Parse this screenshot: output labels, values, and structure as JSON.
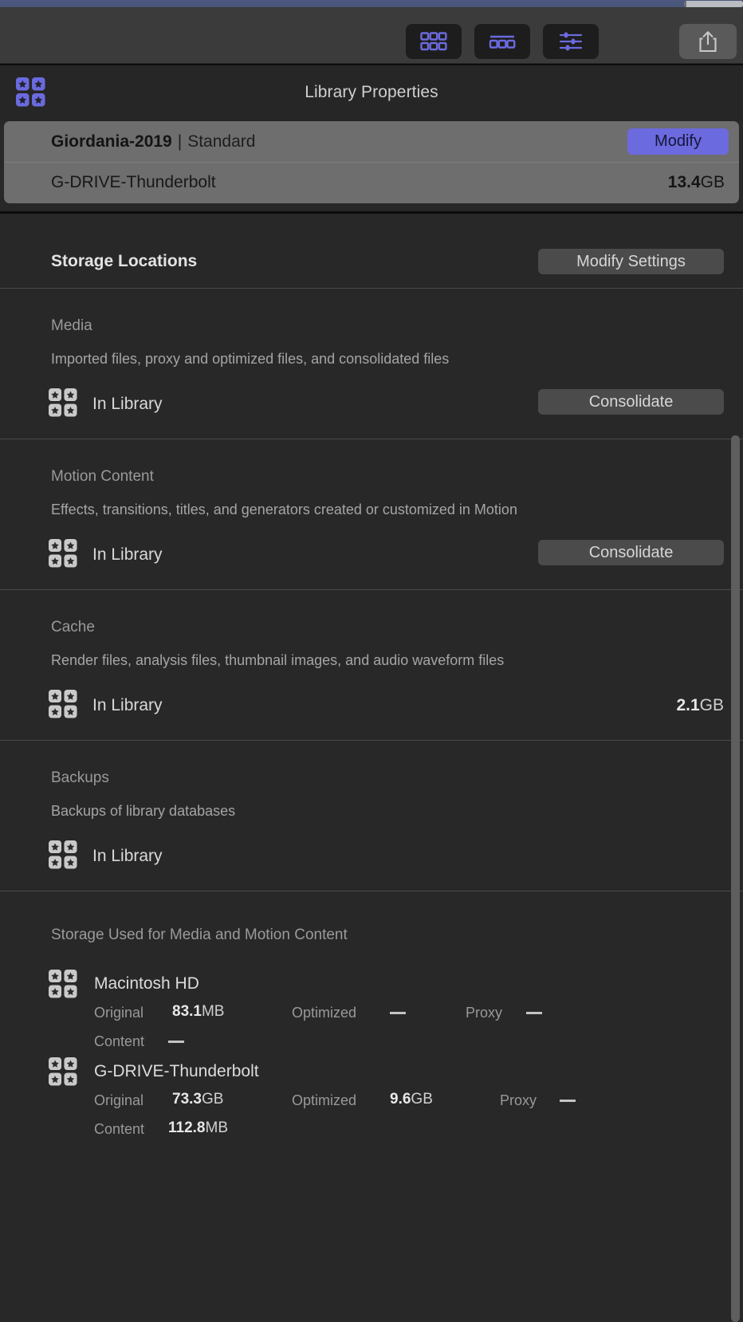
{
  "toolbar": {
    "buttons": [
      {
        "name": "browser-view-button",
        "icon": "grid-six-icon"
      },
      {
        "name": "filmstrip-view-button",
        "icon": "filmstrip-icon"
      },
      {
        "name": "inspector-settings-button",
        "icon": "sliders-icon"
      }
    ],
    "share": {
      "label": "Share",
      "icon": "share-icon"
    },
    "accent_color": "#6b6ade"
  },
  "inspector": {
    "title": "Library Properties",
    "library_icon": "library-stars-icon"
  },
  "library_summary": {
    "name": "Giordania-2019",
    "separator": "|",
    "kind": "Standard",
    "modify_label": "Modify",
    "volume": "G-DRIVE-Thunderbolt",
    "size_value": "13.4",
    "size_unit": "GB"
  },
  "storage_locations": {
    "title": "Storage Locations",
    "modify_settings_label": "Modify Settings",
    "sections": [
      {
        "label": "Media",
        "description": "Imported files, proxy and optimized files, and consolidated files",
        "location": "In Library",
        "action_label": "Consolidate",
        "size_value": "",
        "size_unit": ""
      },
      {
        "label": "Motion Content",
        "description": "Effects, transitions, titles, and generators created or customized in Motion",
        "location": "In Library",
        "action_label": "Consolidate",
        "size_value": "",
        "size_unit": ""
      },
      {
        "label": "Cache",
        "description": "Render files, analysis files, thumbnail images, and audio waveform files",
        "location": "In Library",
        "action_label": "",
        "size_value": "2.1",
        "size_unit": "GB"
      },
      {
        "label": "Backups",
        "description": "Backups of library databases",
        "location": "In Library",
        "action_label": "",
        "size_value": "",
        "size_unit": ""
      }
    ]
  },
  "storage_used": {
    "title": "Storage Used for Media and Motion Content",
    "volumes": [
      {
        "name": "Macintosh HD",
        "original_label": "Original",
        "original_value": "83.1",
        "original_unit": "MB",
        "optimized_label": "Optimized",
        "optimized_value": "—",
        "optimized_unit": "",
        "proxy_label": "Proxy",
        "proxy_value": "—",
        "proxy_unit": "",
        "content_label": "Content",
        "content_value": "—",
        "content_unit": ""
      },
      {
        "name": "G-DRIVE-Thunderbolt",
        "original_label": "Original",
        "original_value": "73.3",
        "original_unit": "GB",
        "optimized_label": "Optimized",
        "optimized_value": "9.6",
        "optimized_unit": "GB",
        "proxy_label": "Proxy",
        "proxy_value": "—",
        "proxy_unit": "",
        "content_label": "Content",
        "content_value": "112.8",
        "content_unit": "MB"
      }
    ]
  }
}
